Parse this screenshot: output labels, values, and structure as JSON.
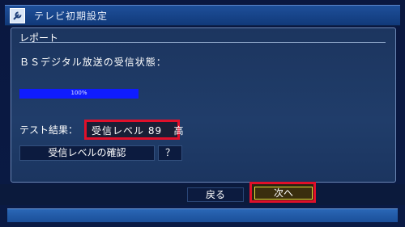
{
  "window": {
    "title": "テレビ初期設定",
    "icon": "wrench-icon"
  },
  "report": {
    "section_label": "レポート",
    "status_label": "ＢＳデジタル放送の受信状態：",
    "progress": {
      "percent": 100,
      "text": "100%"
    },
    "test_label": "テスト結果：",
    "result_text": "受信レベル 89   高"
  },
  "buttons": {
    "confirm": "受信レベルの確認",
    "help": "？",
    "back": "戻る",
    "next": "次へ"
  },
  "colors": {
    "progress_fill": "#0f1cff",
    "highlight_border": "#e0102a",
    "focus_border": "#e9df3a"
  }
}
